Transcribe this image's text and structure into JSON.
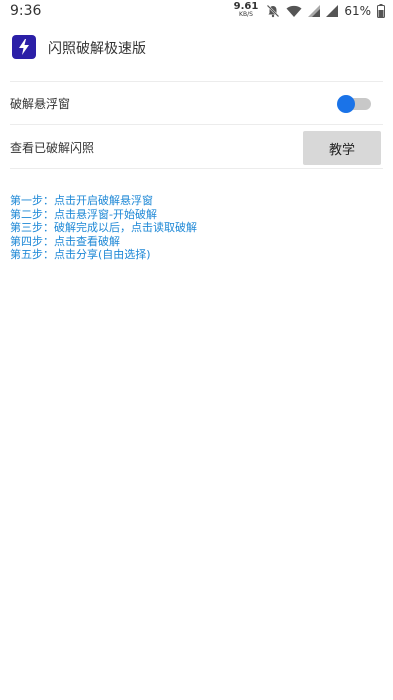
{
  "status_bar": {
    "time": "9:36",
    "speed_value": "9.61",
    "speed_unit": "KB/S",
    "battery_percent": "61%",
    "icons": [
      "mute-icon",
      "wifi-icon",
      "signal-icon",
      "signal-icon",
      "battery-icon"
    ]
  },
  "header": {
    "app_title": "闪照破解极速版",
    "logo_icon": "lightning-icon",
    "logo_color": "#2b1fa7"
  },
  "rows": {
    "float_window_label": "破解悬浮窗",
    "float_window_enabled": true,
    "view_cracked_label": "查看已破解闪照",
    "tutorial_button": "教学"
  },
  "steps": [
    "第一步：点击开启破解悬浮窗",
    "第二步：点击悬浮窗-开始破解",
    "第三步：破解完成以后，点击读取破解",
    "第四步：点击查看破解",
    "第五步：点击分享(自由选择)"
  ],
  "colors": {
    "accent": "#1a73e8",
    "step_text": "#1e88d6"
  }
}
